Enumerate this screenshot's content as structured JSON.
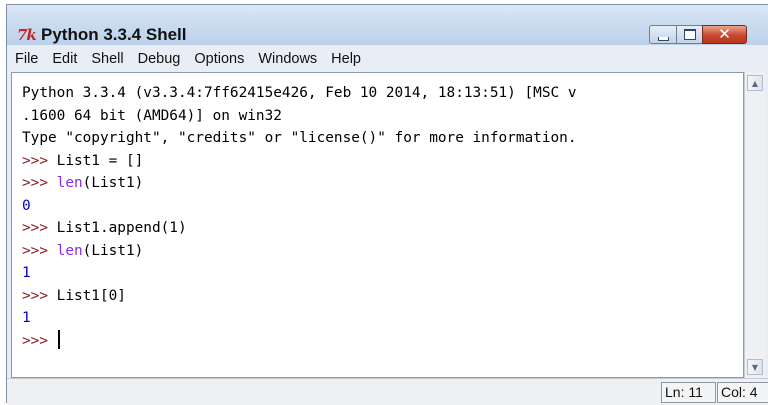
{
  "window": {
    "icon_text": "7k",
    "title": "Python 3.3.4 Shell",
    "close_glyph": "✕"
  },
  "menubar": {
    "items": [
      {
        "label": "File"
      },
      {
        "label": "Edit"
      },
      {
        "label": "Shell"
      },
      {
        "label": "Debug"
      },
      {
        "label": "Options"
      },
      {
        "label": "Windows"
      },
      {
        "label": "Help"
      }
    ]
  },
  "shell": {
    "lines": [
      {
        "segments": [
          {
            "text": "Python 3.3.4 (v3.3.4:7ff62415e426, Feb 10 2014, 18:13:51) [MSC v",
            "kind": "plain"
          }
        ]
      },
      {
        "segments": [
          {
            "text": ".1600 64 bit (AMD64)] on win32",
            "kind": "plain"
          }
        ]
      },
      {
        "segments": [
          {
            "text": "Type \"copyright\", \"credits\" or \"license()\" for more information.",
            "kind": "plain"
          }
        ]
      },
      {
        "segments": [
          {
            "text": ">>> ",
            "kind": "prompt"
          },
          {
            "text": "List1 = []",
            "kind": "plain"
          }
        ]
      },
      {
        "segments": [
          {
            "text": ">>> ",
            "kind": "prompt"
          },
          {
            "text": "len",
            "kind": "builtin"
          },
          {
            "text": "(List1)",
            "kind": "plain"
          }
        ]
      },
      {
        "segments": [
          {
            "text": "0",
            "kind": "output"
          }
        ]
      },
      {
        "segments": [
          {
            "text": ">>> ",
            "kind": "prompt"
          },
          {
            "text": "List1.append(1)",
            "kind": "plain"
          }
        ]
      },
      {
        "segments": [
          {
            "text": ">>> ",
            "kind": "prompt"
          },
          {
            "text": "len",
            "kind": "builtin"
          },
          {
            "text": "(List1)",
            "kind": "plain"
          }
        ]
      },
      {
        "segments": [
          {
            "text": "1",
            "kind": "output"
          }
        ]
      },
      {
        "segments": [
          {
            "text": ">>> ",
            "kind": "prompt"
          },
          {
            "text": "List1[0]",
            "kind": "plain"
          }
        ]
      },
      {
        "segments": [
          {
            "text": "1",
            "kind": "output"
          }
        ]
      },
      {
        "segments": [
          {
            "text": ">>> ",
            "kind": "prompt"
          }
        ],
        "cursor": true
      }
    ]
  },
  "scrollbar": {
    "up_icon": "▲",
    "down_icon": "▼"
  },
  "status": {
    "line_text": "Ln: 11",
    "col_text": "Col: 4"
  },
  "colors": {
    "prompt": "#8b1a1a",
    "builtin": "#8a2be2",
    "output": "#0000c8"
  }
}
